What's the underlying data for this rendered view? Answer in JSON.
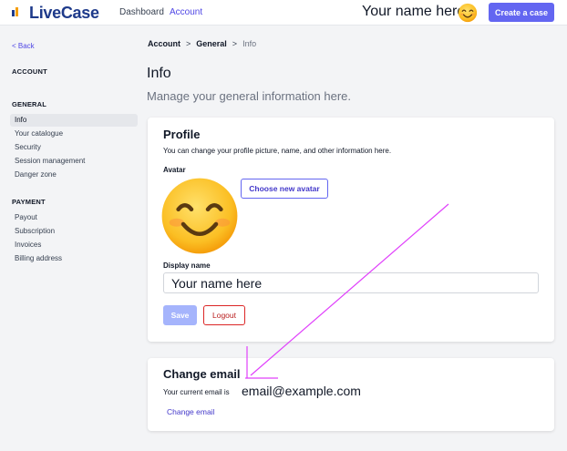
{
  "header": {
    "brand": "LiveCase",
    "nav": [
      "Dashboard",
      "Account"
    ],
    "user_name": "Your name here",
    "create_label": "Create a case"
  },
  "sidebar": {
    "back": "< Back",
    "account_heading": "ACCOUNT",
    "general_heading": "GENERAL",
    "general_items": [
      "Info",
      "Your catalogue",
      "Security",
      "Session management",
      "Danger zone"
    ],
    "payment_heading": "PAYMENT",
    "payment_items": [
      "Payout",
      "Subscription",
      "Invoices",
      "Billing address"
    ]
  },
  "breadcrumb": {
    "items": [
      "Account",
      "General",
      "Info"
    ],
    "separator": ">"
  },
  "page": {
    "title": "Info",
    "subtitle": "Manage your general information here."
  },
  "profile": {
    "title": "Profile",
    "description": "You can change your profile picture, name, and other information here.",
    "avatar_label": "Avatar",
    "choose_avatar": "Choose new avatar",
    "display_name_label": "Display name",
    "display_name_value": "Your name here",
    "save": "Save",
    "logout": "Logout"
  },
  "email": {
    "title": "Change email",
    "current_label": "Your current email is",
    "current_value": "email@example.com",
    "change_link": "Change email"
  },
  "colors": {
    "accent": "#6366f1",
    "brand": "#1e3a8a",
    "danger": "#dc2626",
    "annotation": "#e040fb"
  },
  "icons": {
    "avatar": "smiling-face-icon",
    "logo": "livecase-logo-icon"
  }
}
